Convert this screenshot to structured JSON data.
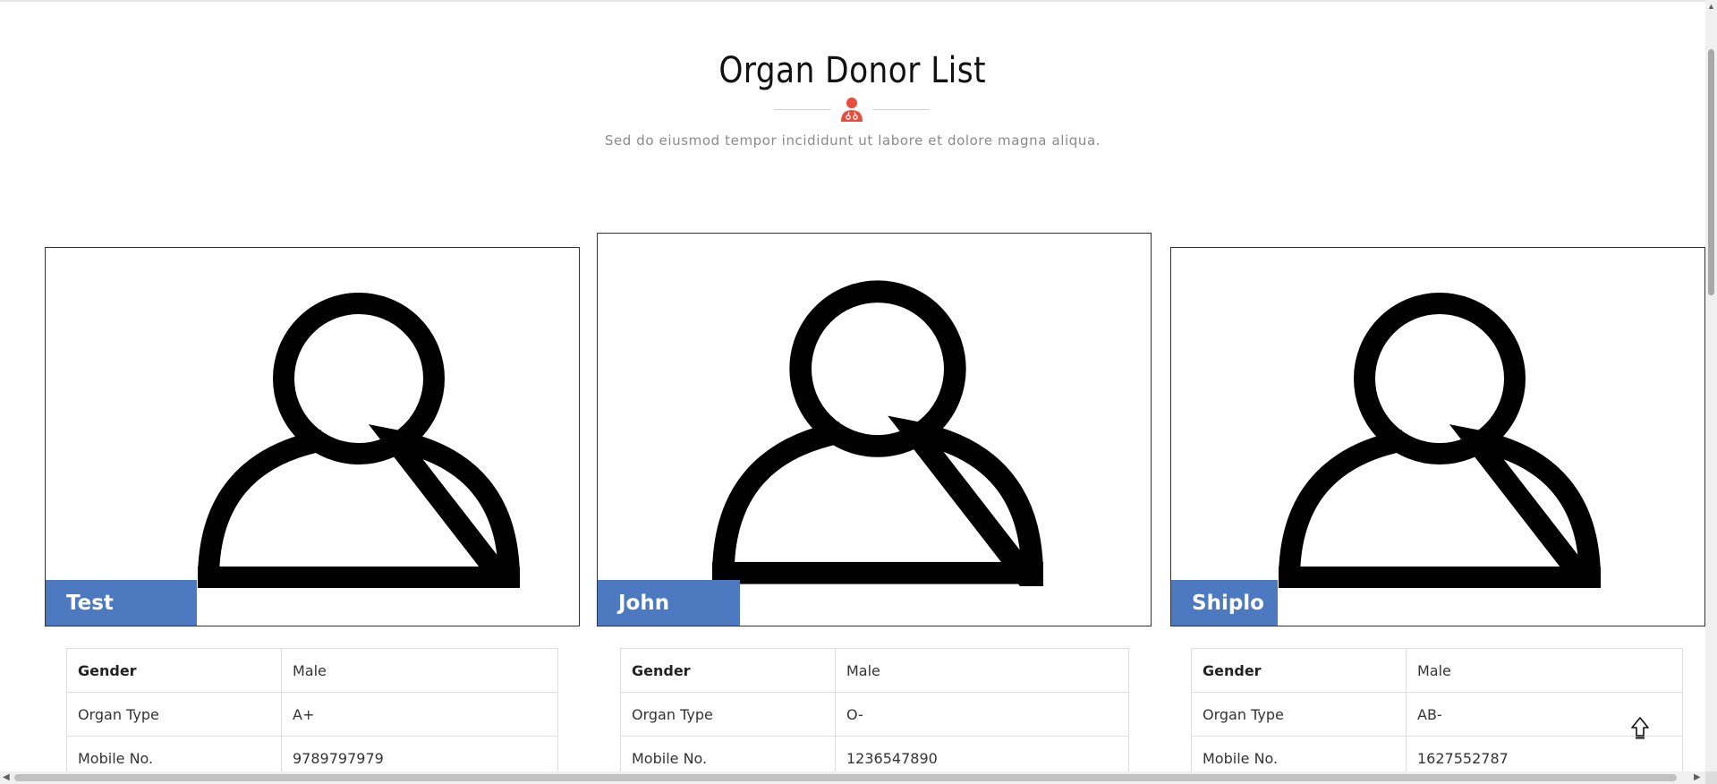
{
  "page": {
    "title": "Organ Donor List",
    "subtitle": "Sed do eiusmod tempor incididunt ut labore et dolore magna aliqua.",
    "divider_icon": "doctor-icon",
    "accent_color": "#e74c3c",
    "tag_color": "#4c79c0"
  },
  "donors": [
    {
      "name": "Test Demo",
      "photo_icon": "person-placeholder-icon",
      "rows": [
        {
          "label": "Gender",
          "value": "Male"
        },
        {
          "label": "Organ Type",
          "value": "A+"
        },
        {
          "label": "Mobile No.",
          "value": "9789797979"
        }
      ]
    },
    {
      "name": "John Doe",
      "photo_icon": "person-placeholder-icon",
      "rows": [
        {
          "label": "Gender",
          "value": "Male"
        },
        {
          "label": "Organ Type",
          "value": "O-"
        },
        {
          "label": "Mobile No.",
          "value": "1236547890"
        }
      ]
    },
    {
      "name": "Shiplo",
      "photo_icon": "person-placeholder-icon",
      "rows": [
        {
          "label": "Gender",
          "value": "Male"
        },
        {
          "label": "Organ Type",
          "value": "AB-"
        },
        {
          "label": "Mobile No.",
          "value": "1627552787"
        }
      ]
    }
  ],
  "controls": {
    "scroll_top_icon": "arrow-up-icon"
  }
}
